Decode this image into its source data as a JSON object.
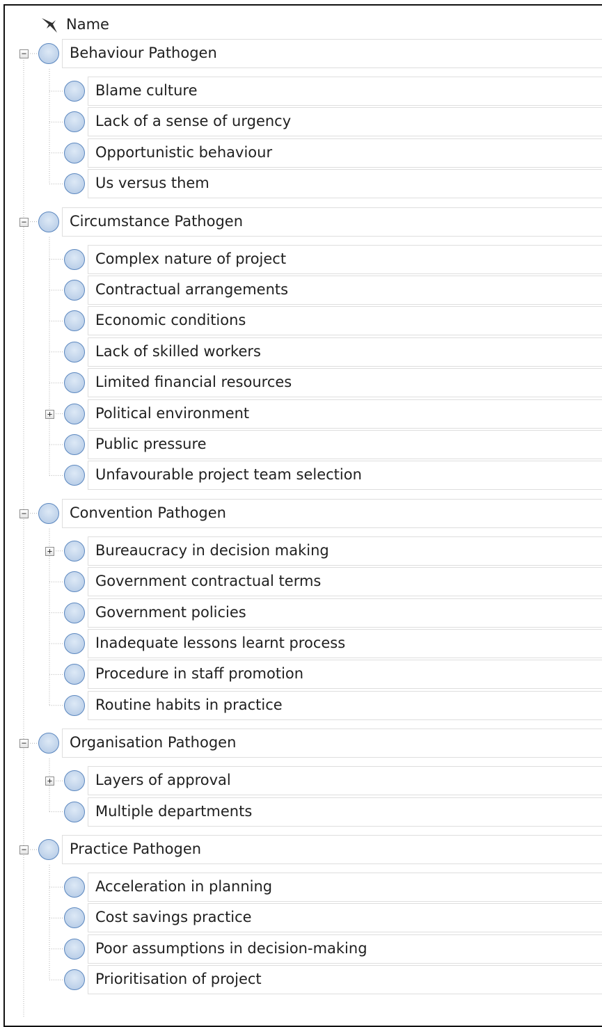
{
  "header": {
    "column_name": "Name",
    "pin_icon": "pin-icon"
  },
  "tree": [
    {
      "label": "Behaviour Pathogen",
      "expanded": true,
      "children": [
        {
          "label": "Blame culture",
          "expandable": false
        },
        {
          "label": "Lack of a sense of urgency",
          "expandable": false
        },
        {
          "label": "Opportunistic behaviour",
          "expandable": false
        },
        {
          "label": "Us versus them",
          "expandable": false
        }
      ]
    },
    {
      "label": "Circumstance Pathogen",
      "expanded": true,
      "children": [
        {
          "label": "Complex nature of project",
          "expandable": false
        },
        {
          "label": "Contractual arrangements",
          "expandable": false
        },
        {
          "label": "Economic conditions",
          "expandable": false
        },
        {
          "label": "Lack of skilled workers",
          "expandable": false
        },
        {
          "label": "Limited financial resources",
          "expandable": false
        },
        {
          "label": "Political environment",
          "expandable": true
        },
        {
          "label": "Public pressure",
          "expandable": false
        },
        {
          "label": "Unfavourable project team selection",
          "expandable": false
        }
      ]
    },
    {
      "label": "Convention Pathogen",
      "expanded": true,
      "children": [
        {
          "label": "Bureaucracy in decision making",
          "expandable": true
        },
        {
          "label": "Government contractual terms",
          "expandable": false
        },
        {
          "label": "Government policies",
          "expandable": false
        },
        {
          "label": "Inadequate lessons learnt process",
          "expandable": false
        },
        {
          "label": "Procedure in staff promotion",
          "expandable": false
        },
        {
          "label": "Routine habits in practice",
          "expandable": false
        }
      ]
    },
    {
      "label": "Organisation Pathogen",
      "expanded": true,
      "children": [
        {
          "label": "Layers of approval",
          "expandable": true
        },
        {
          "label": "Multiple departments",
          "expandable": false
        }
      ]
    },
    {
      "label": "Practice Pathogen",
      "expanded": true,
      "children": [
        {
          "label": "Acceleration in planning",
          "expandable": false
        },
        {
          "label": "Cost savings practice",
          "expandable": false
        },
        {
          "label": "Poor assumptions in decision-making",
          "expandable": false
        },
        {
          "label": "Prioritisation of project",
          "expandable": false
        }
      ]
    }
  ],
  "colors": {
    "node_fill": "#c4d6ec",
    "node_border": "#5b87bf",
    "row_border": "#dedede",
    "tree_line": "#b0b0b0"
  }
}
